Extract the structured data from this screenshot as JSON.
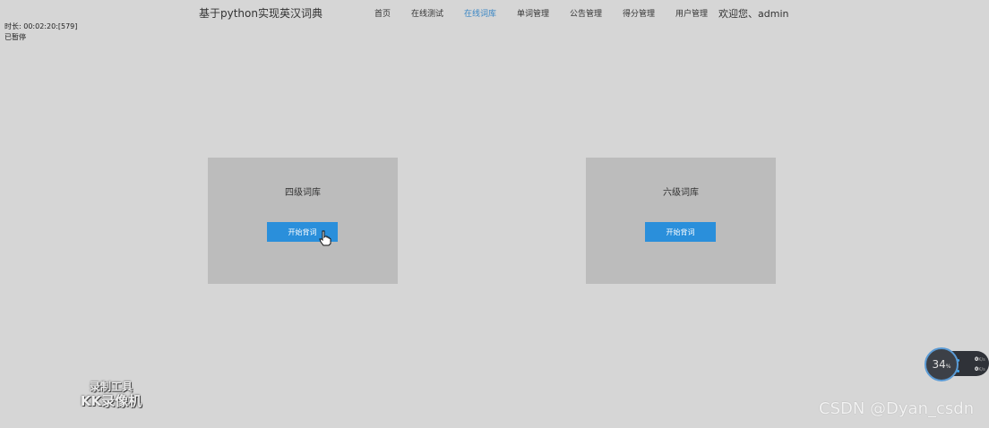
{
  "header": {
    "site_title": "基于python实现英汉词典",
    "nav": [
      {
        "label": "首页"
      },
      {
        "label": "在线测试"
      },
      {
        "label": "在线词库",
        "active": true
      },
      {
        "label": "单词管理"
      },
      {
        "label": "公告管理"
      },
      {
        "label": "得分管理"
      },
      {
        "label": "用户管理"
      }
    ],
    "welcome": "欢迎您、admin"
  },
  "recording": {
    "time_line": "时长: 00:02:20:[579]",
    "status_line": "已暂停",
    "tool_line1": "录制工具",
    "tool_line2": "KK录像机"
  },
  "cards": [
    {
      "title": "四级词库",
      "button": "开始背词"
    },
    {
      "title": "六级词库",
      "button": "开始背词"
    }
  ],
  "monitor": {
    "value": "34",
    "unit": "%",
    "up": "0",
    "down": "0",
    "speed_unit": "K/s"
  },
  "watermark": "CSDN @Dyan_csdn",
  "colors": {
    "active_nav": "#3a86c4",
    "button": "#2a8fdb",
    "card": "#bcbcbc",
    "background": "#d6d6d6"
  }
}
